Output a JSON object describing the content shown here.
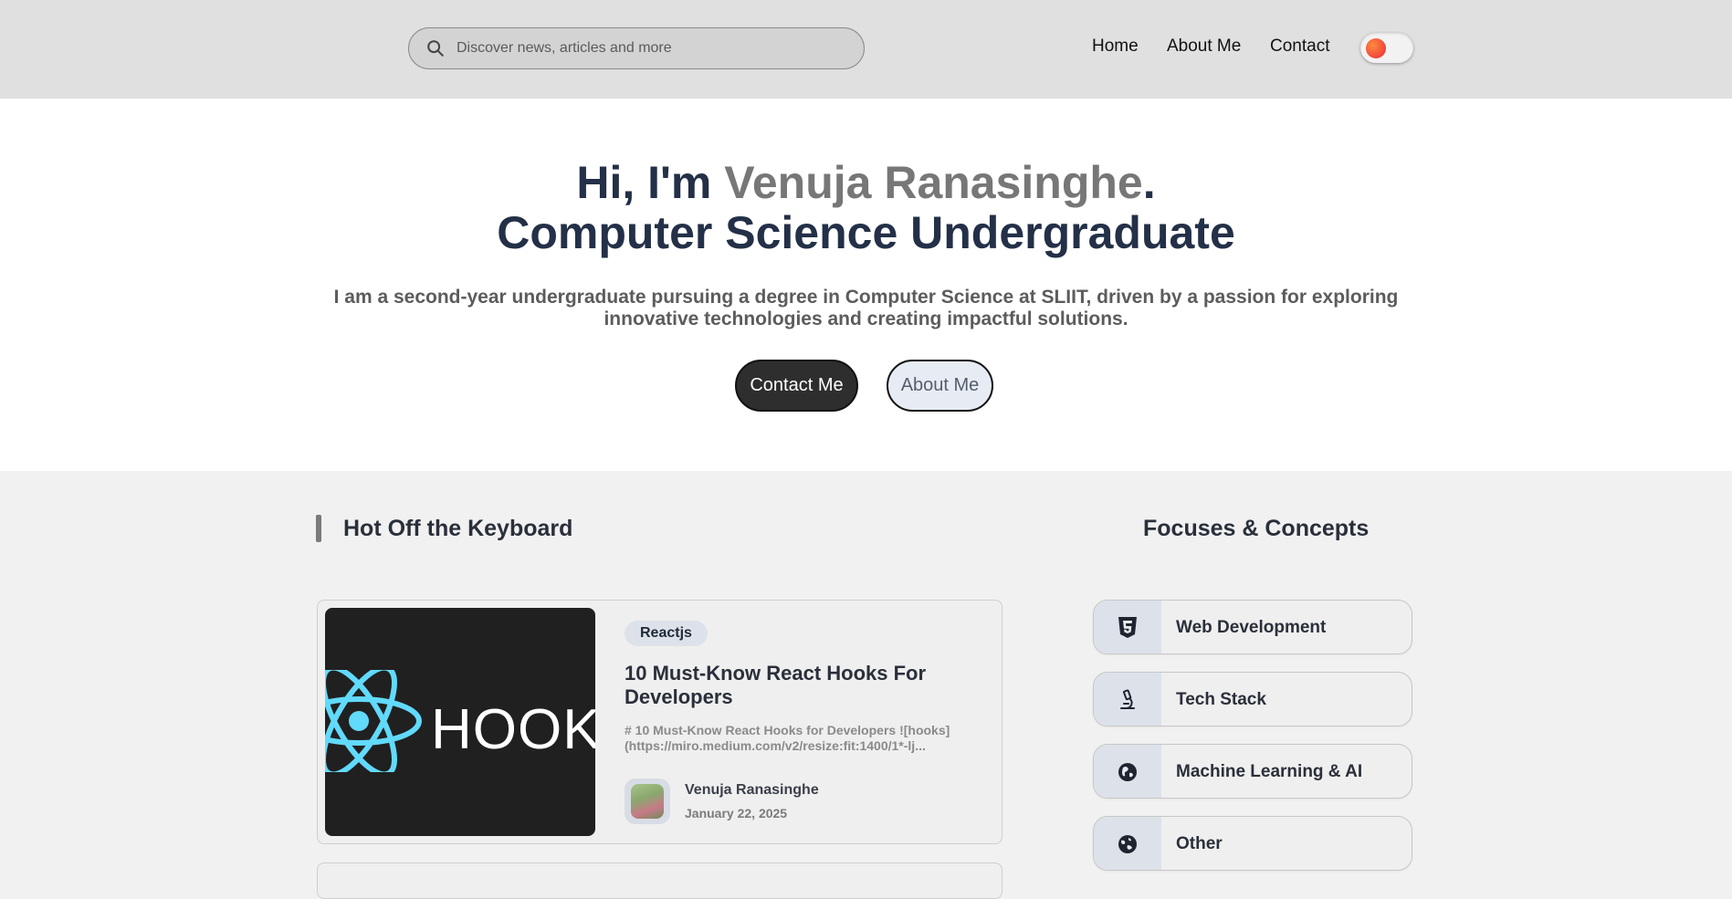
{
  "header": {
    "search_placeholder": "Discover news, articles and more",
    "nav": [
      "Home",
      "About Me",
      "Contact"
    ],
    "theme_toggle_color": "#f0443a"
  },
  "hero": {
    "greeting": "Hi, I'm ",
    "name": "Venuja Ranasinghe",
    "punct": ".",
    "role": "Computer Science Undergraduate",
    "description": "I am a second-year undergraduate pursuing a degree in Computer Science at SLIIT, driven by a passion for exploring innovative technologies and creating impactful solutions.",
    "primary_button": "Contact Me",
    "secondary_button": "About Me"
  },
  "posts_section": {
    "title": "Hot Off the Keyboard",
    "posts": [
      {
        "tag": "Reactjs",
        "title": "10 Must-Know React Hooks For Developers",
        "excerpt": "# 10 Must-Know React Hooks for Developers ![hooks](https://miro.medium.com/v2/resize:fit:1400/1*-lj...",
        "thumbnail_text": "HOOKS",
        "author": "Venuja Ranasinghe",
        "date": "January 22, 2025"
      }
    ]
  },
  "focus_section": {
    "title": "Focuses & Concepts",
    "items": [
      {
        "label": "Web Development",
        "icon": "html5-icon"
      },
      {
        "label": "Tech Stack",
        "icon": "microscope-icon"
      },
      {
        "label": "Machine Learning & AI",
        "icon": "brain-globe-icon"
      },
      {
        "label": "Other",
        "icon": "globe-icon"
      }
    ]
  }
}
